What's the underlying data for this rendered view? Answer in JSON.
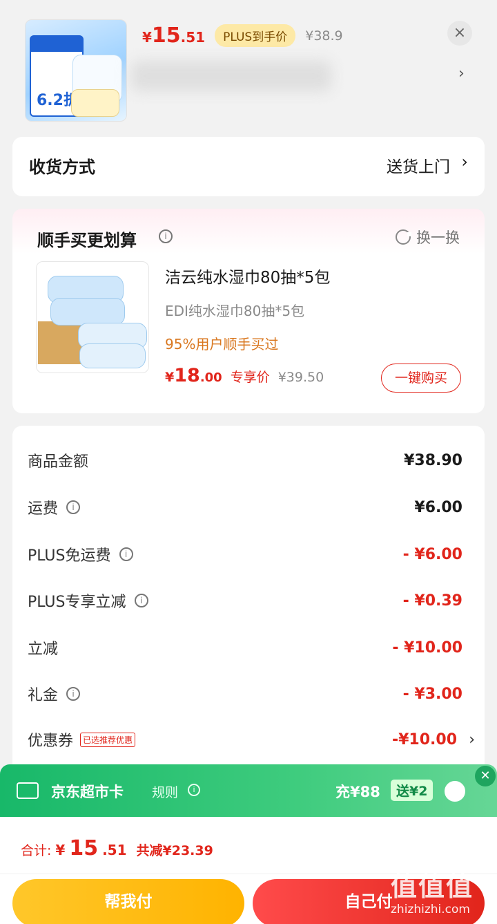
{
  "top": {
    "product_thumb_text": "6.2折",
    "price": {
      "symbol": "¥",
      "integer": "15",
      "decimal": ".51"
    },
    "plus_badge": "PLUS到手价",
    "original_price": "¥38.9",
    "close_label": "×",
    "chevron": "›"
  },
  "delivery": {
    "label": "收货方式",
    "value": "送货上门",
    "chevron": "›"
  },
  "addon": {
    "title": "顺手买更划算",
    "info_icon": "i",
    "swap_label": "换一换",
    "product": {
      "name": "洁云纯水湿巾80抽*5包",
      "subtitle": "EDI纯水湿巾80抽*5包",
      "tip": "95%用户顺手买过",
      "price": {
        "symbol": "¥",
        "integer": "18",
        "decimal": ".00"
      },
      "price_tag": "专享价",
      "original_price": "¥39.50",
      "buy_button": "一键购买"
    }
  },
  "summary": {
    "rows": [
      {
        "label": "商品金额",
        "value": "¥38.90",
        "red": false,
        "info": false
      },
      {
        "label": "运费",
        "value": "¥6.00",
        "red": false,
        "info": true
      },
      {
        "label": "PLUS免运费",
        "value": "- ¥6.00",
        "red": true,
        "info": true
      },
      {
        "label": "PLUS专享立减",
        "value": "- ¥0.39",
        "red": true,
        "info": true
      },
      {
        "label": "立减",
        "value": "- ¥10.00",
        "red": true,
        "info": false
      },
      {
        "label": "礼金",
        "value": "- ¥3.00",
        "red": true,
        "info": true
      },
      {
        "label": "优惠券",
        "value": "-¥10.00",
        "red": true,
        "info": false,
        "tag": "已选推荐优惠"
      }
    ]
  },
  "market_card": {
    "name": "京东超市卡",
    "rule": "规则",
    "charge": "充¥88",
    "gift": "送¥2",
    "close": "✕"
  },
  "footer": {
    "total_label": "合计:",
    "total": {
      "symbol": "¥",
      "integer": "15",
      "decimal": ".51"
    },
    "saved": "共减¥23.39",
    "help_pay": "帮我付",
    "self_pay": "自己付"
  },
  "watermark": {
    "text": "值值值",
    "url": "zhizhizhi.com"
  },
  "colors": {
    "accent_red": "#e1251b",
    "green": "#18b869",
    "gold": "#ffb300"
  }
}
